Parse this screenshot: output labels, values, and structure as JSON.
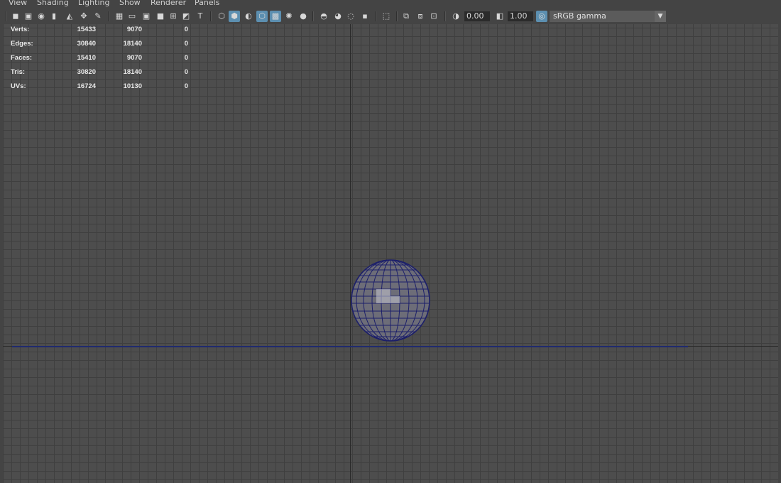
{
  "menu": {
    "view": "View",
    "shading": "Shading",
    "lighting": "Lighting",
    "show": "Show",
    "renderer": "Renderer",
    "panels": "Panels"
  },
  "toolbar": {
    "exposure_value": "0.00",
    "gamma_value": "1.00",
    "color_space": "sRGB gamma",
    "accent_color": "#5c8fb0"
  },
  "hud": {
    "rows": [
      {
        "label": "Verts:",
        "c1": "15433",
        "c2": "9070",
        "c3": "0"
      },
      {
        "label": "Edges:",
        "c1": "30840",
        "c2": "18140",
        "c3": "0"
      },
      {
        "label": "Faces:",
        "c1": "15410",
        "c2": "9070",
        "c3": "0"
      },
      {
        "label": "Tris:",
        "c1": "30820",
        "c2": "18140",
        "c3": "0"
      },
      {
        "label": "UVs:",
        "c1": "16724",
        "c2": "10130",
        "c3": "0"
      }
    ]
  },
  "viewport": {
    "object": "sphere-wireframe",
    "wire_color": "#1c1f6a",
    "grid_color": "#3f3f3f",
    "background_color": "#4d4d4d"
  }
}
